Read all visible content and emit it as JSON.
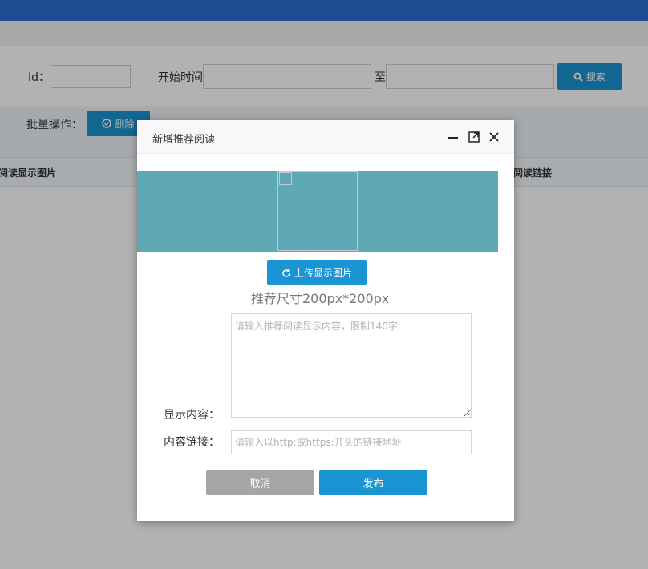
{
  "filters": {
    "id_label": "Id：",
    "start_time_label": "开始时间",
    "to_label": "至",
    "search_label": "搜索"
  },
  "batch": {
    "label": "批量操作：",
    "delete_label": "删除"
  },
  "table": {
    "columns": [
      "阅读显示图片",
      "阅读链接"
    ]
  },
  "modal": {
    "title": "新增推荐阅读",
    "upload_label": "上传显示图片",
    "size_hint": "推荐尺寸200px*200px",
    "content_label": "显示内容：",
    "content_placeholder": "请输入推荐阅读显示内容，限制140字",
    "link_label": "内容链接：",
    "link_placeholder": "请输入以http:或https:开头的链接地址",
    "cancel_label": "取消",
    "publish_label": "发布"
  },
  "colors": {
    "topbar": "#2d6fd3",
    "accent": "#1a94d2",
    "banner": "#5fa9b7",
    "cancel": "#a5a5a5"
  }
}
